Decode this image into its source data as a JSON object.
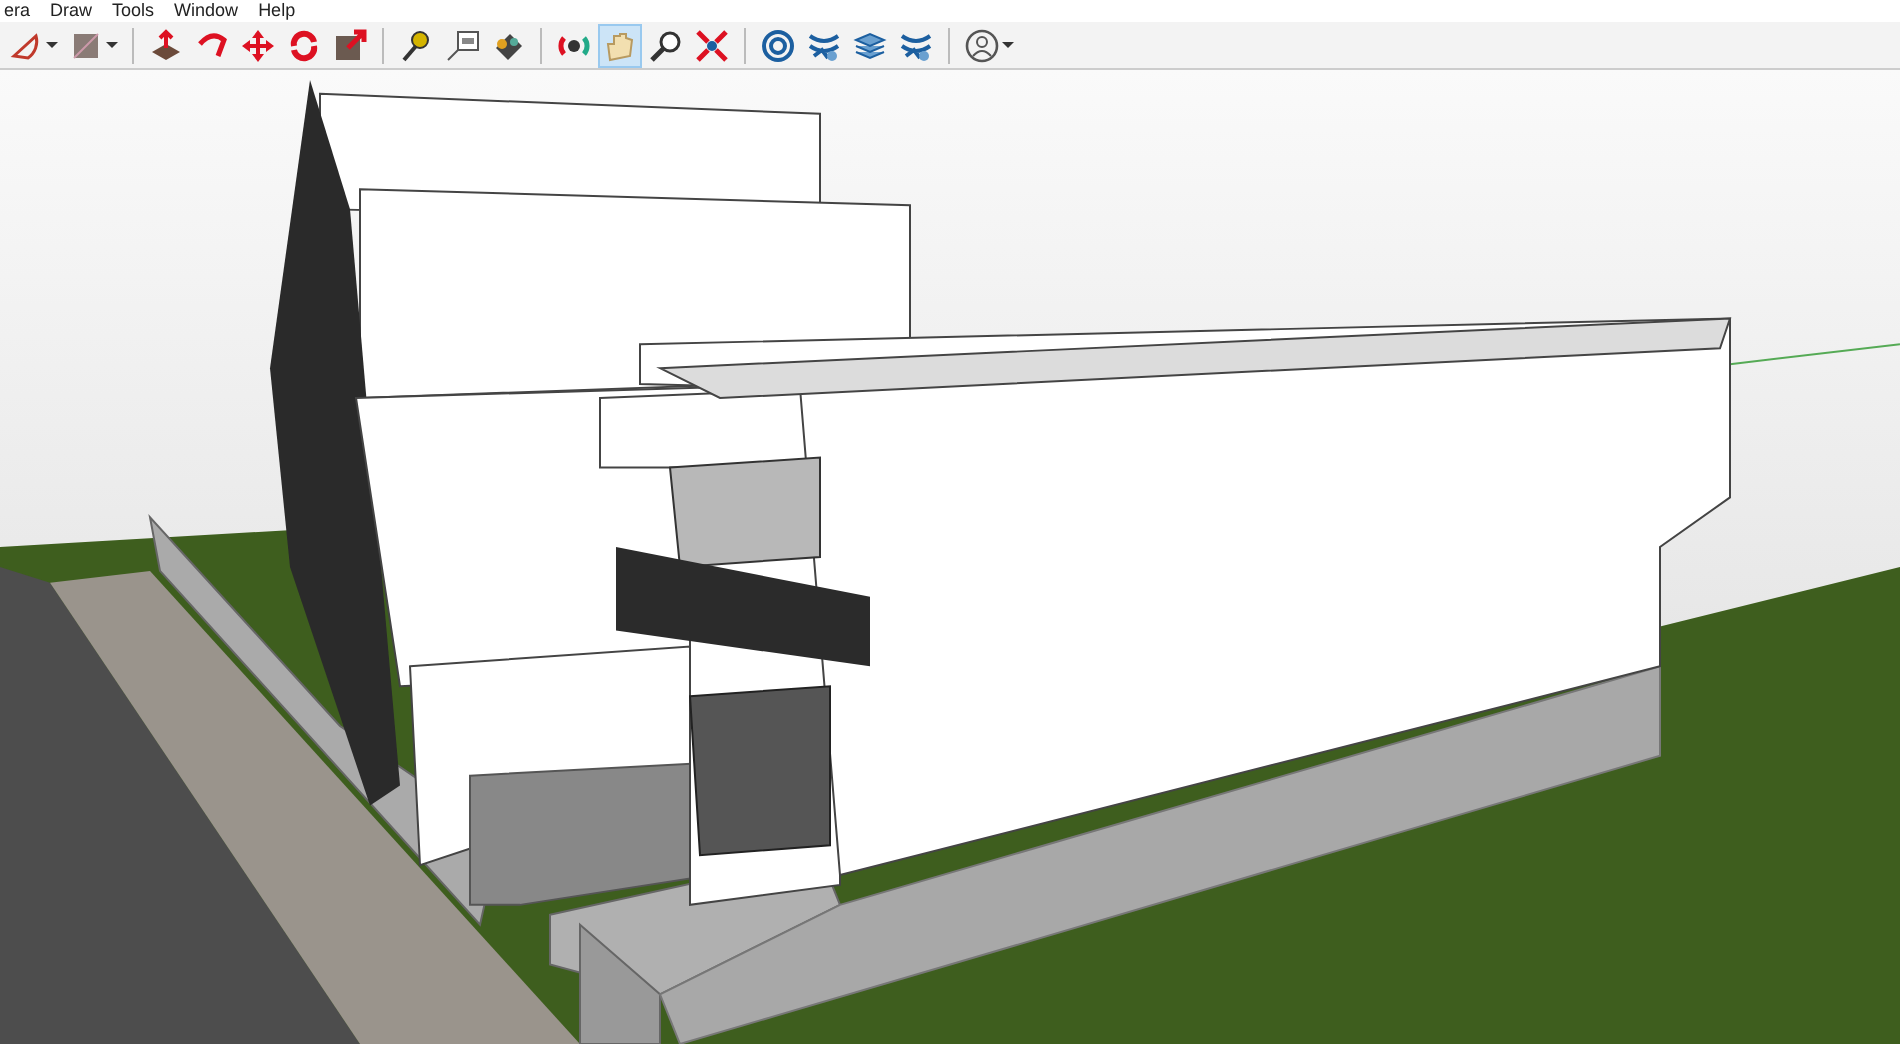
{
  "menu_bar": {
    "items": [
      "era",
      "Draw",
      "Tools",
      "Window",
      "Help"
    ]
  },
  "toolbar": {
    "groups": [
      [
        {
          "kind": "arc",
          "dropdown": true,
          "selected": false
        },
        {
          "kind": "material",
          "dropdown": true,
          "selected": false
        }
      ],
      [
        {
          "kind": "pushpull",
          "dropdown": false,
          "selected": false
        },
        {
          "kind": "followme",
          "dropdown": false,
          "selected": false
        },
        {
          "kind": "move",
          "dropdown": false,
          "selected": false
        },
        {
          "kind": "rotate",
          "dropdown": false,
          "selected": false
        },
        {
          "kind": "scale",
          "dropdown": false,
          "selected": false
        }
      ],
      [
        {
          "kind": "tape",
          "dropdown": false,
          "selected": false
        },
        {
          "kind": "text",
          "dropdown": false,
          "selected": false
        },
        {
          "kind": "paint",
          "dropdown": false,
          "selected": false
        }
      ],
      [
        {
          "kind": "orbit",
          "dropdown": false,
          "selected": false
        },
        {
          "kind": "pan",
          "dropdown": false,
          "selected": true
        },
        {
          "kind": "zoom",
          "dropdown": false,
          "selected": false
        },
        {
          "kind": "extents",
          "dropdown": false,
          "selected": false
        }
      ],
      [
        {
          "kind": "location",
          "dropdown": false,
          "selected": false
        },
        {
          "kind": "terrain",
          "dropdown": false,
          "selected": false
        },
        {
          "kind": "layers",
          "dropdown": false,
          "selected": false
        },
        {
          "kind": "sandbox",
          "dropdown": false,
          "selected": false
        }
      ],
      [
        {
          "kind": "account",
          "dropdown": true,
          "selected": false
        }
      ]
    ]
  }
}
